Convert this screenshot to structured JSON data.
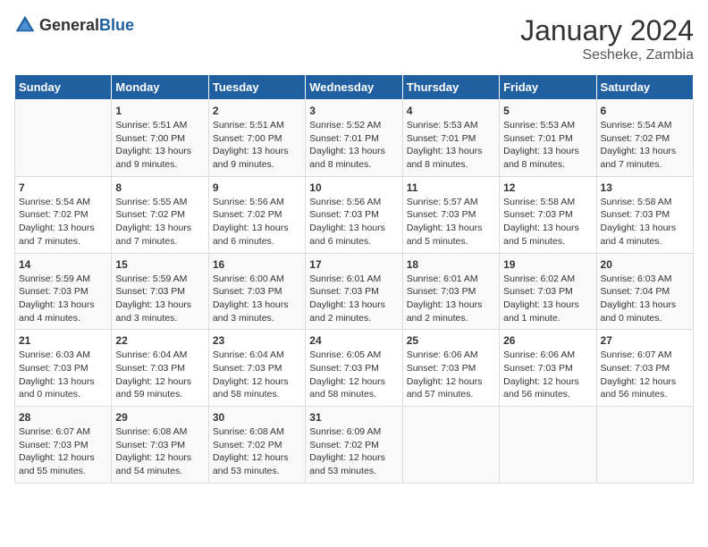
{
  "header": {
    "logo_general": "General",
    "logo_blue": "Blue",
    "month": "January 2024",
    "location": "Sesheke, Zambia"
  },
  "weekdays": [
    "Sunday",
    "Monday",
    "Tuesday",
    "Wednesday",
    "Thursday",
    "Friday",
    "Saturday"
  ],
  "weeks": [
    [
      {
        "day": "",
        "info": ""
      },
      {
        "day": "1",
        "info": "Sunrise: 5:51 AM\nSunset: 7:00 PM\nDaylight: 13 hours\nand 9 minutes."
      },
      {
        "day": "2",
        "info": "Sunrise: 5:51 AM\nSunset: 7:00 PM\nDaylight: 13 hours\nand 9 minutes."
      },
      {
        "day": "3",
        "info": "Sunrise: 5:52 AM\nSunset: 7:01 PM\nDaylight: 13 hours\nand 8 minutes."
      },
      {
        "day": "4",
        "info": "Sunrise: 5:53 AM\nSunset: 7:01 PM\nDaylight: 13 hours\nand 8 minutes."
      },
      {
        "day": "5",
        "info": "Sunrise: 5:53 AM\nSunset: 7:01 PM\nDaylight: 13 hours\nand 8 minutes."
      },
      {
        "day": "6",
        "info": "Sunrise: 5:54 AM\nSunset: 7:02 PM\nDaylight: 13 hours\nand 7 minutes."
      }
    ],
    [
      {
        "day": "7",
        "info": "Sunrise: 5:54 AM\nSunset: 7:02 PM\nDaylight: 13 hours\nand 7 minutes."
      },
      {
        "day": "8",
        "info": "Sunrise: 5:55 AM\nSunset: 7:02 PM\nDaylight: 13 hours\nand 7 minutes."
      },
      {
        "day": "9",
        "info": "Sunrise: 5:56 AM\nSunset: 7:02 PM\nDaylight: 13 hours\nand 6 minutes."
      },
      {
        "day": "10",
        "info": "Sunrise: 5:56 AM\nSunset: 7:03 PM\nDaylight: 13 hours\nand 6 minutes."
      },
      {
        "day": "11",
        "info": "Sunrise: 5:57 AM\nSunset: 7:03 PM\nDaylight: 13 hours\nand 5 minutes."
      },
      {
        "day": "12",
        "info": "Sunrise: 5:58 AM\nSunset: 7:03 PM\nDaylight: 13 hours\nand 5 minutes."
      },
      {
        "day": "13",
        "info": "Sunrise: 5:58 AM\nSunset: 7:03 PM\nDaylight: 13 hours\nand 4 minutes."
      }
    ],
    [
      {
        "day": "14",
        "info": "Sunrise: 5:59 AM\nSunset: 7:03 PM\nDaylight: 13 hours\nand 4 minutes."
      },
      {
        "day": "15",
        "info": "Sunrise: 5:59 AM\nSunset: 7:03 PM\nDaylight: 13 hours\nand 3 minutes."
      },
      {
        "day": "16",
        "info": "Sunrise: 6:00 AM\nSunset: 7:03 PM\nDaylight: 13 hours\nand 3 minutes."
      },
      {
        "day": "17",
        "info": "Sunrise: 6:01 AM\nSunset: 7:03 PM\nDaylight: 13 hours\nand 2 minutes."
      },
      {
        "day": "18",
        "info": "Sunrise: 6:01 AM\nSunset: 7:03 PM\nDaylight: 13 hours\nand 2 minutes."
      },
      {
        "day": "19",
        "info": "Sunrise: 6:02 AM\nSunset: 7:03 PM\nDaylight: 13 hours\nand 1 minute."
      },
      {
        "day": "20",
        "info": "Sunrise: 6:03 AM\nSunset: 7:04 PM\nDaylight: 13 hours\nand 0 minutes."
      }
    ],
    [
      {
        "day": "21",
        "info": "Sunrise: 6:03 AM\nSunset: 7:03 PM\nDaylight: 13 hours\nand 0 minutes."
      },
      {
        "day": "22",
        "info": "Sunrise: 6:04 AM\nSunset: 7:03 PM\nDaylight: 12 hours\nand 59 minutes."
      },
      {
        "day": "23",
        "info": "Sunrise: 6:04 AM\nSunset: 7:03 PM\nDaylight: 12 hours\nand 58 minutes."
      },
      {
        "day": "24",
        "info": "Sunrise: 6:05 AM\nSunset: 7:03 PM\nDaylight: 12 hours\nand 58 minutes."
      },
      {
        "day": "25",
        "info": "Sunrise: 6:06 AM\nSunset: 7:03 PM\nDaylight: 12 hours\nand 57 minutes."
      },
      {
        "day": "26",
        "info": "Sunrise: 6:06 AM\nSunset: 7:03 PM\nDaylight: 12 hours\nand 56 minutes."
      },
      {
        "day": "27",
        "info": "Sunrise: 6:07 AM\nSunset: 7:03 PM\nDaylight: 12 hours\nand 56 minutes."
      }
    ],
    [
      {
        "day": "28",
        "info": "Sunrise: 6:07 AM\nSunset: 7:03 PM\nDaylight: 12 hours\nand 55 minutes."
      },
      {
        "day": "29",
        "info": "Sunrise: 6:08 AM\nSunset: 7:03 PM\nDaylight: 12 hours\nand 54 minutes."
      },
      {
        "day": "30",
        "info": "Sunrise: 6:08 AM\nSunset: 7:02 PM\nDaylight: 12 hours\nand 53 minutes."
      },
      {
        "day": "31",
        "info": "Sunrise: 6:09 AM\nSunset: 7:02 PM\nDaylight: 12 hours\nand 53 minutes."
      },
      {
        "day": "",
        "info": ""
      },
      {
        "day": "",
        "info": ""
      },
      {
        "day": "",
        "info": ""
      }
    ]
  ]
}
